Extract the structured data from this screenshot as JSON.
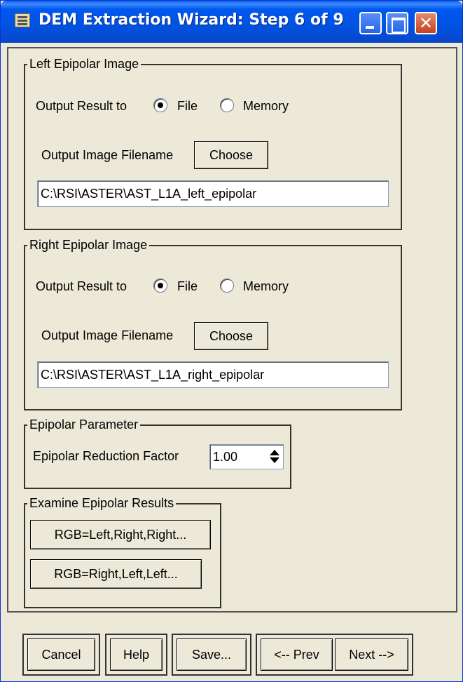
{
  "window": {
    "title": "DEM Extraction Wizard: Step 6 of 9",
    "icon": "app-icon",
    "controls": [
      "minimize-icon",
      "maximize-icon",
      "close-icon"
    ],
    "close_glyph": "✕"
  },
  "left_epipolar": {
    "legend": "Left Epipolar Image",
    "output_label": "Output Result to",
    "option_file": "File",
    "option_memory": "Memory",
    "selected": "File",
    "filename_label": "Output Image Filename",
    "choose_label": "Choose",
    "filename_value": "C:\\RSI\\ASTER\\AST_L1A_left_epipolar"
  },
  "right_epipolar": {
    "legend": "Right Epipolar Image",
    "output_label": "Output Result to",
    "option_file": "File",
    "option_memory": "Memory",
    "selected": "File",
    "filename_label": "Output Image Filename",
    "choose_label": "Choose",
    "filename_value": "C:\\RSI\\ASTER\\AST_L1A_right_epipolar"
  },
  "epipolar_parameter": {
    "legend": "Epipolar Parameter",
    "reduction_label": "Epipolar Reduction Factor",
    "reduction_value": "1.00"
  },
  "examine": {
    "legend": "Examine Epipolar Results",
    "rgb_left_label": "RGB=Left,Right,Right...",
    "rgb_right_label": "RGB=Right,Left,Left..."
  },
  "footer": {
    "cancel": "Cancel",
    "help": "Help",
    "save": "Save...",
    "prev": "<-- Prev",
    "next": "Next -->"
  },
  "colors": {
    "titlebar": "#0054e3",
    "dialog_bg": "#ece9d8",
    "close_button": "#c8401f"
  }
}
